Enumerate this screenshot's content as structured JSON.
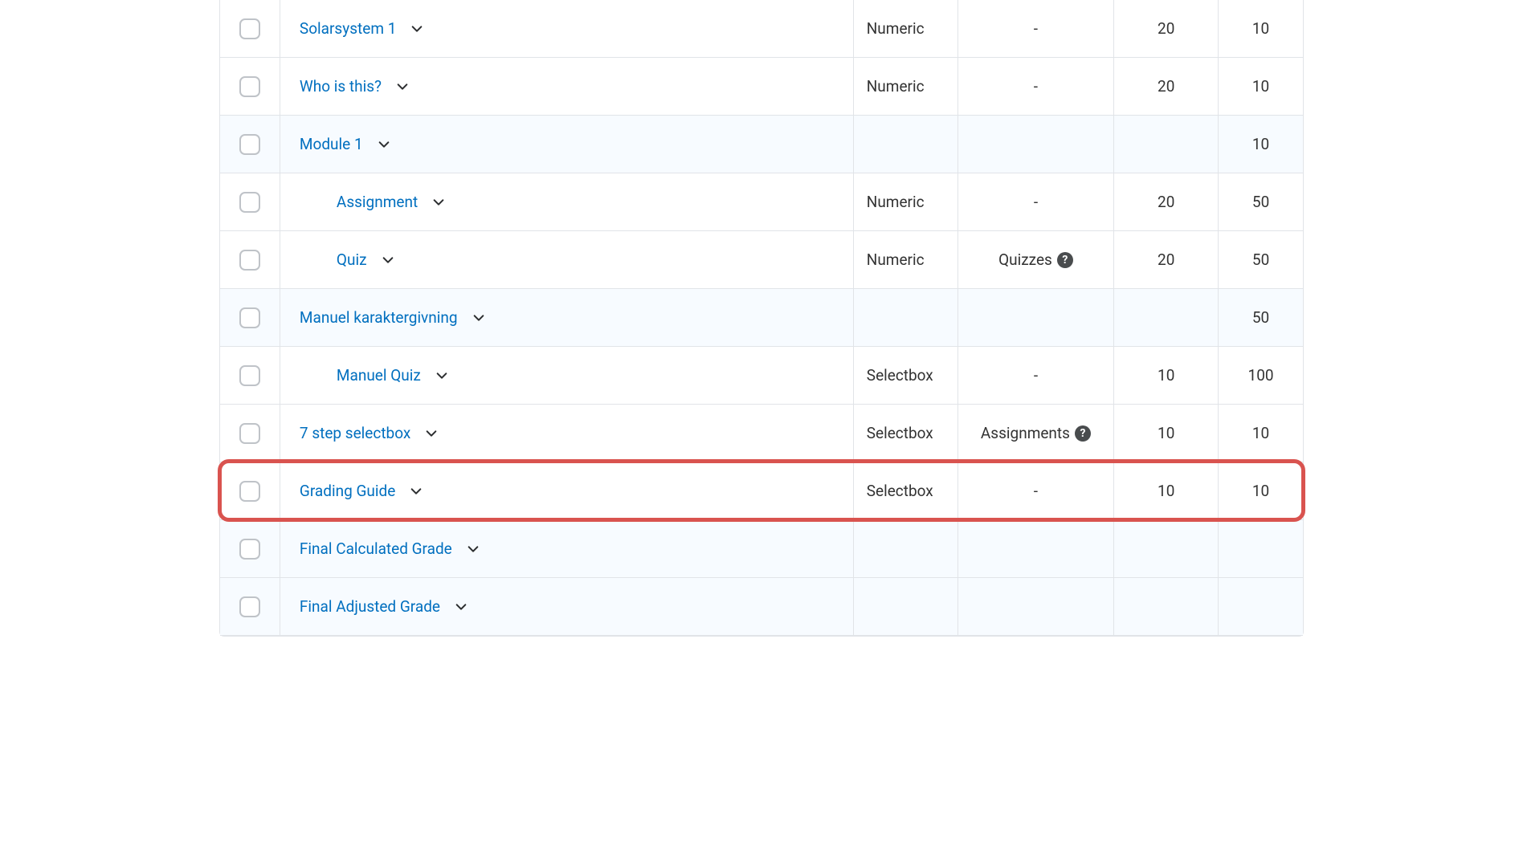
{
  "rows": [
    {
      "label": "Solarsystem 1",
      "indent": 0,
      "shaded": false,
      "type": "Numeric",
      "assoc": "-",
      "help": false,
      "num1": "20",
      "num2": "10"
    },
    {
      "label": "Who is this?",
      "indent": 0,
      "shaded": false,
      "type": "Numeric",
      "assoc": "-",
      "help": false,
      "num1": "20",
      "num2": "10"
    },
    {
      "label": "Module 1",
      "indent": 0,
      "shaded": true,
      "type": "",
      "assoc": "",
      "help": false,
      "num1": "",
      "num2": "10"
    },
    {
      "label": "Assignment",
      "indent": 1,
      "shaded": false,
      "type": "Numeric",
      "assoc": "-",
      "help": false,
      "num1": "20",
      "num2": "50"
    },
    {
      "label": "Quiz",
      "indent": 1,
      "shaded": false,
      "type": "Numeric",
      "assoc": "Quizzes",
      "help": true,
      "num1": "20",
      "num2": "50"
    },
    {
      "label": "Manuel karaktergivning",
      "indent": 0,
      "shaded": true,
      "type": "",
      "assoc": "",
      "help": false,
      "num1": "",
      "num2": "50"
    },
    {
      "label": "Manuel Quiz",
      "indent": 1,
      "shaded": false,
      "type": "Selectbox",
      "assoc": "-",
      "help": false,
      "num1": "10",
      "num2": "100"
    },
    {
      "label": "7 step selectbox",
      "indent": 0,
      "shaded": false,
      "type": "Selectbox",
      "assoc": "Assignments",
      "help": true,
      "num1": "10",
      "num2": "10"
    },
    {
      "label": "Grading Guide",
      "indent": 0,
      "shaded": false,
      "type": "Selectbox",
      "assoc": "-",
      "help": false,
      "num1": "10",
      "num2": "10",
      "highlight": true
    },
    {
      "label": "Final Calculated Grade",
      "indent": 0,
      "shaded": true,
      "type": "",
      "assoc": "",
      "help": false,
      "num1": "",
      "num2": ""
    },
    {
      "label": "Final Adjusted Grade",
      "indent": 0,
      "shaded": true,
      "type": "",
      "assoc": "",
      "help": false,
      "num1": "",
      "num2": ""
    }
  ],
  "icons": {
    "help_glyph": "?"
  }
}
